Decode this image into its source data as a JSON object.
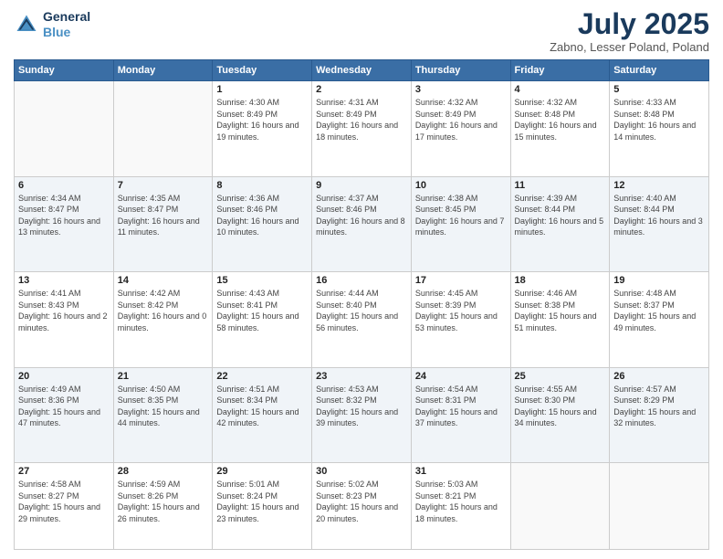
{
  "header": {
    "logo_line1": "General",
    "logo_line2": "Blue",
    "month": "July 2025",
    "location": "Zabno, Lesser Poland, Poland"
  },
  "days_of_week": [
    "Sunday",
    "Monday",
    "Tuesday",
    "Wednesday",
    "Thursday",
    "Friday",
    "Saturday"
  ],
  "weeks": [
    [
      {
        "day": "",
        "info": ""
      },
      {
        "day": "",
        "info": ""
      },
      {
        "day": "1",
        "info": "Sunrise: 4:30 AM\nSunset: 8:49 PM\nDaylight: 16 hours\nand 19 minutes."
      },
      {
        "day": "2",
        "info": "Sunrise: 4:31 AM\nSunset: 8:49 PM\nDaylight: 16 hours\nand 18 minutes."
      },
      {
        "day": "3",
        "info": "Sunrise: 4:32 AM\nSunset: 8:49 PM\nDaylight: 16 hours\nand 17 minutes."
      },
      {
        "day": "4",
        "info": "Sunrise: 4:32 AM\nSunset: 8:48 PM\nDaylight: 16 hours\nand 15 minutes."
      },
      {
        "day": "5",
        "info": "Sunrise: 4:33 AM\nSunset: 8:48 PM\nDaylight: 16 hours\nand 14 minutes."
      }
    ],
    [
      {
        "day": "6",
        "info": "Sunrise: 4:34 AM\nSunset: 8:47 PM\nDaylight: 16 hours\nand 13 minutes."
      },
      {
        "day": "7",
        "info": "Sunrise: 4:35 AM\nSunset: 8:47 PM\nDaylight: 16 hours\nand 11 minutes."
      },
      {
        "day": "8",
        "info": "Sunrise: 4:36 AM\nSunset: 8:46 PM\nDaylight: 16 hours\nand 10 minutes."
      },
      {
        "day": "9",
        "info": "Sunrise: 4:37 AM\nSunset: 8:46 PM\nDaylight: 16 hours\nand 8 minutes."
      },
      {
        "day": "10",
        "info": "Sunrise: 4:38 AM\nSunset: 8:45 PM\nDaylight: 16 hours\nand 7 minutes."
      },
      {
        "day": "11",
        "info": "Sunrise: 4:39 AM\nSunset: 8:44 PM\nDaylight: 16 hours\nand 5 minutes."
      },
      {
        "day": "12",
        "info": "Sunrise: 4:40 AM\nSunset: 8:44 PM\nDaylight: 16 hours\nand 3 minutes."
      }
    ],
    [
      {
        "day": "13",
        "info": "Sunrise: 4:41 AM\nSunset: 8:43 PM\nDaylight: 16 hours\nand 2 minutes."
      },
      {
        "day": "14",
        "info": "Sunrise: 4:42 AM\nSunset: 8:42 PM\nDaylight: 16 hours\nand 0 minutes."
      },
      {
        "day": "15",
        "info": "Sunrise: 4:43 AM\nSunset: 8:41 PM\nDaylight: 15 hours\nand 58 minutes."
      },
      {
        "day": "16",
        "info": "Sunrise: 4:44 AM\nSunset: 8:40 PM\nDaylight: 15 hours\nand 56 minutes."
      },
      {
        "day": "17",
        "info": "Sunrise: 4:45 AM\nSunset: 8:39 PM\nDaylight: 15 hours\nand 53 minutes."
      },
      {
        "day": "18",
        "info": "Sunrise: 4:46 AM\nSunset: 8:38 PM\nDaylight: 15 hours\nand 51 minutes."
      },
      {
        "day": "19",
        "info": "Sunrise: 4:48 AM\nSunset: 8:37 PM\nDaylight: 15 hours\nand 49 minutes."
      }
    ],
    [
      {
        "day": "20",
        "info": "Sunrise: 4:49 AM\nSunset: 8:36 PM\nDaylight: 15 hours\nand 47 minutes."
      },
      {
        "day": "21",
        "info": "Sunrise: 4:50 AM\nSunset: 8:35 PM\nDaylight: 15 hours\nand 44 minutes."
      },
      {
        "day": "22",
        "info": "Sunrise: 4:51 AM\nSunset: 8:34 PM\nDaylight: 15 hours\nand 42 minutes."
      },
      {
        "day": "23",
        "info": "Sunrise: 4:53 AM\nSunset: 8:32 PM\nDaylight: 15 hours\nand 39 minutes."
      },
      {
        "day": "24",
        "info": "Sunrise: 4:54 AM\nSunset: 8:31 PM\nDaylight: 15 hours\nand 37 minutes."
      },
      {
        "day": "25",
        "info": "Sunrise: 4:55 AM\nSunset: 8:30 PM\nDaylight: 15 hours\nand 34 minutes."
      },
      {
        "day": "26",
        "info": "Sunrise: 4:57 AM\nSunset: 8:29 PM\nDaylight: 15 hours\nand 32 minutes."
      }
    ],
    [
      {
        "day": "27",
        "info": "Sunrise: 4:58 AM\nSunset: 8:27 PM\nDaylight: 15 hours\nand 29 minutes."
      },
      {
        "day": "28",
        "info": "Sunrise: 4:59 AM\nSunset: 8:26 PM\nDaylight: 15 hours\nand 26 minutes."
      },
      {
        "day": "29",
        "info": "Sunrise: 5:01 AM\nSunset: 8:24 PM\nDaylight: 15 hours\nand 23 minutes."
      },
      {
        "day": "30",
        "info": "Sunrise: 5:02 AM\nSunset: 8:23 PM\nDaylight: 15 hours\nand 20 minutes."
      },
      {
        "day": "31",
        "info": "Sunrise: 5:03 AM\nSunset: 8:21 PM\nDaylight: 15 hours\nand 18 minutes."
      },
      {
        "day": "",
        "info": ""
      },
      {
        "day": "",
        "info": ""
      }
    ]
  ]
}
